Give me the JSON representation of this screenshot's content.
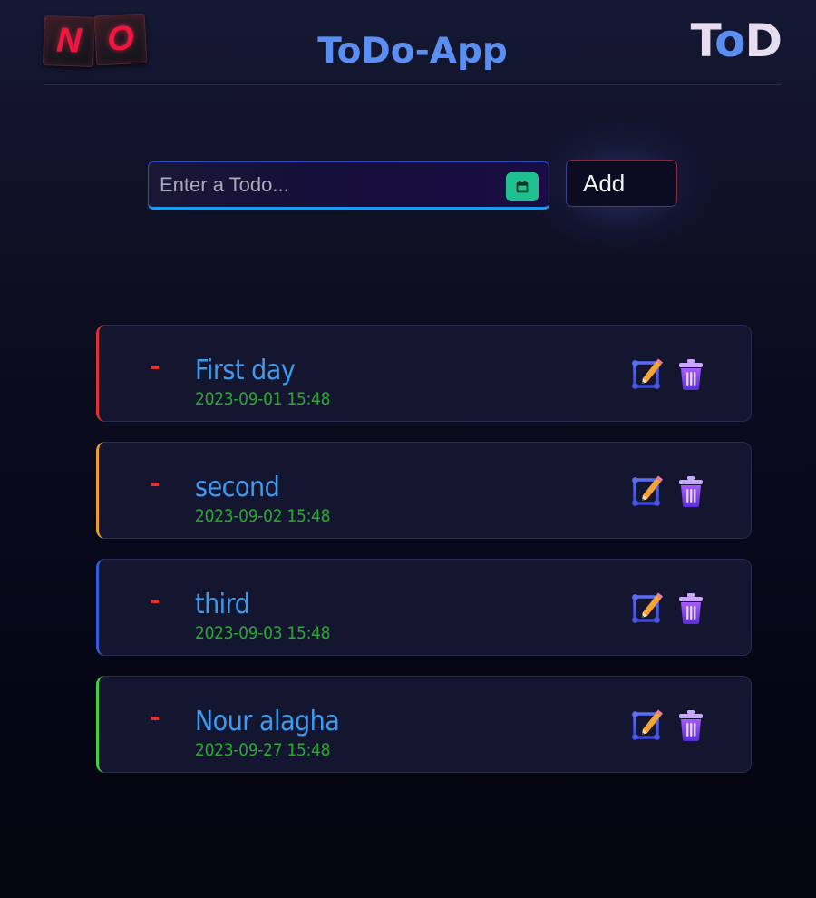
{
  "header": {
    "logo_letters": [
      "N",
      "O"
    ],
    "title": "ToDo-App",
    "brand": {
      "part1": "T",
      "part2": "o",
      "part3": "D"
    }
  },
  "input": {
    "placeholder": "Enter a Todo...",
    "value": "",
    "calendar_icon": "calendar-icon",
    "add_label": "Add"
  },
  "colors": {
    "accent_blue": "#5b8ef2",
    "title_blue": "#3e9bf0",
    "date_green": "#2aa832",
    "dash_red": "#e53030",
    "calendar_teal": "#1fbf8f"
  },
  "todos": [
    {
      "title": "First day",
      "date": "2023-09-01 15:48",
      "marker": "-",
      "accent_color": "#e03030"
    },
    {
      "title": "second",
      "date": "2023-09-02 15:48",
      "marker": "-",
      "accent_color": "#f0a020"
    },
    {
      "title": "third",
      "date": "2023-09-03 15:48",
      "marker": "-",
      "accent_color": "#2f5fe0"
    },
    {
      "title": "Nour alagha",
      "date": "2023-09-27 15:48",
      "marker": "-",
      "accent_color": "#40d040"
    }
  ]
}
